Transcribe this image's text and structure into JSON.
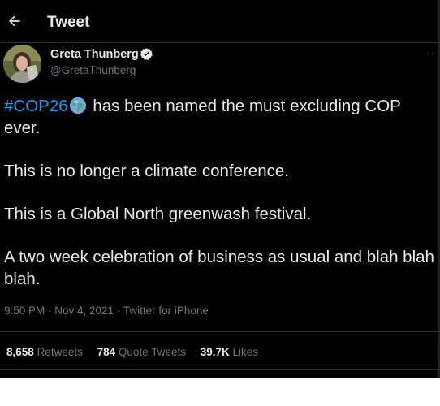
{
  "header": {
    "title": "Tweet",
    "back_icon": "arrow-left-icon"
  },
  "author": {
    "name": "Greta Thunberg",
    "handle": "@GretaThunberg",
    "verified_icon": "verified-badge-icon"
  },
  "tweet": {
    "hashtag": "#COP26",
    "emoji_icon": "earth-globe-icon",
    "para1_rest": " has been named the must excluding COP ever.",
    "para2": "This is no longer a climate conference.",
    "para3": "This is a Global North greenwash festival.",
    "para4": "A two week celebration of business as usual and blah blah blah."
  },
  "meta": {
    "time": "9:50 PM · Nov 4, 2021",
    "separator": " · ",
    "source": "Twitter for iPhone"
  },
  "stats": {
    "retweets_count": "8,658",
    "retweets_label": "Retweets",
    "quotes_count": "784",
    "quotes_label": "Quote Tweets",
    "likes_count": "39.7K",
    "likes_label": "Likes"
  },
  "colors": {
    "background": "#000000",
    "text": "#e7e9ea",
    "secondary": "#71767b",
    "accent": "#1d9bf0"
  }
}
